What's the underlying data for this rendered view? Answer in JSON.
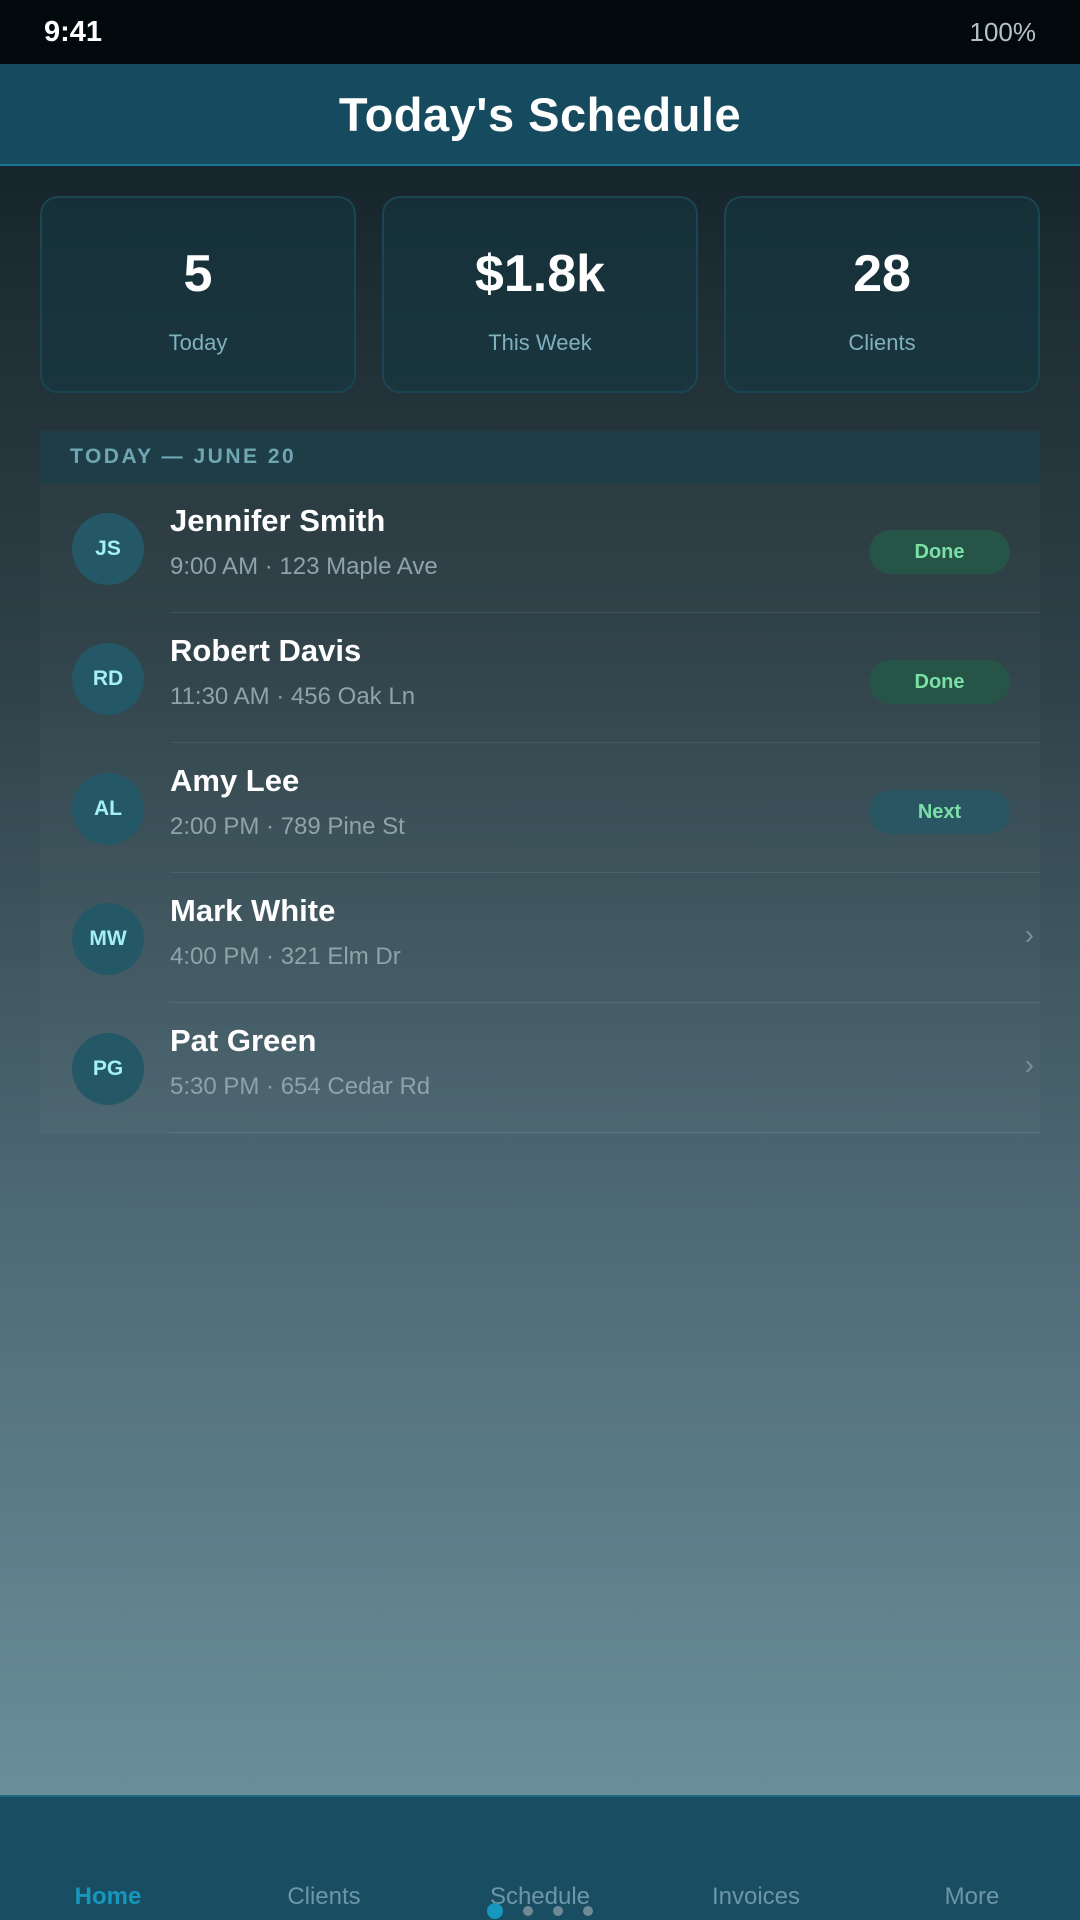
{
  "status_bar": {
    "time": "9:41",
    "battery": "100%"
  },
  "header": {
    "title": "Today's Schedule"
  },
  "stats": [
    {
      "value": "5",
      "label": "Today"
    },
    {
      "value": "$1.8k",
      "label": "This Week"
    },
    {
      "value": "28",
      "label": "Clients"
    }
  ],
  "schedule": {
    "section_title": "TODAY — JUNE 20",
    "appointments": [
      {
        "initials": "JS",
        "name": "Jennifer Smith",
        "details": "9:00 AM · 123 Maple Ave",
        "status": "Done"
      },
      {
        "initials": "RD",
        "name": "Robert Davis",
        "details": "11:30 AM · 456 Oak Ln",
        "status": "Done"
      },
      {
        "initials": "AL",
        "name": "Amy Lee",
        "details": "2:00 PM · 789 Pine St",
        "status": "Next"
      },
      {
        "initials": "MW",
        "name": "Mark White",
        "details": "4:00 PM · 321 Elm Dr",
        "chevron": "›"
      },
      {
        "initials": "PG",
        "name": "Pat Green",
        "details": "5:30 PM · 654 Cedar Rd",
        "chevron": "›"
      }
    ]
  },
  "tabbar": {
    "tabs": [
      "Home",
      "Clients",
      "Schedule",
      "Invoices",
      "More"
    ],
    "active_tab": "Home"
  },
  "colors": {
    "accent": "#1597be",
    "done_text": "#7be0a8",
    "header_bg": "#164a5f"
  }
}
